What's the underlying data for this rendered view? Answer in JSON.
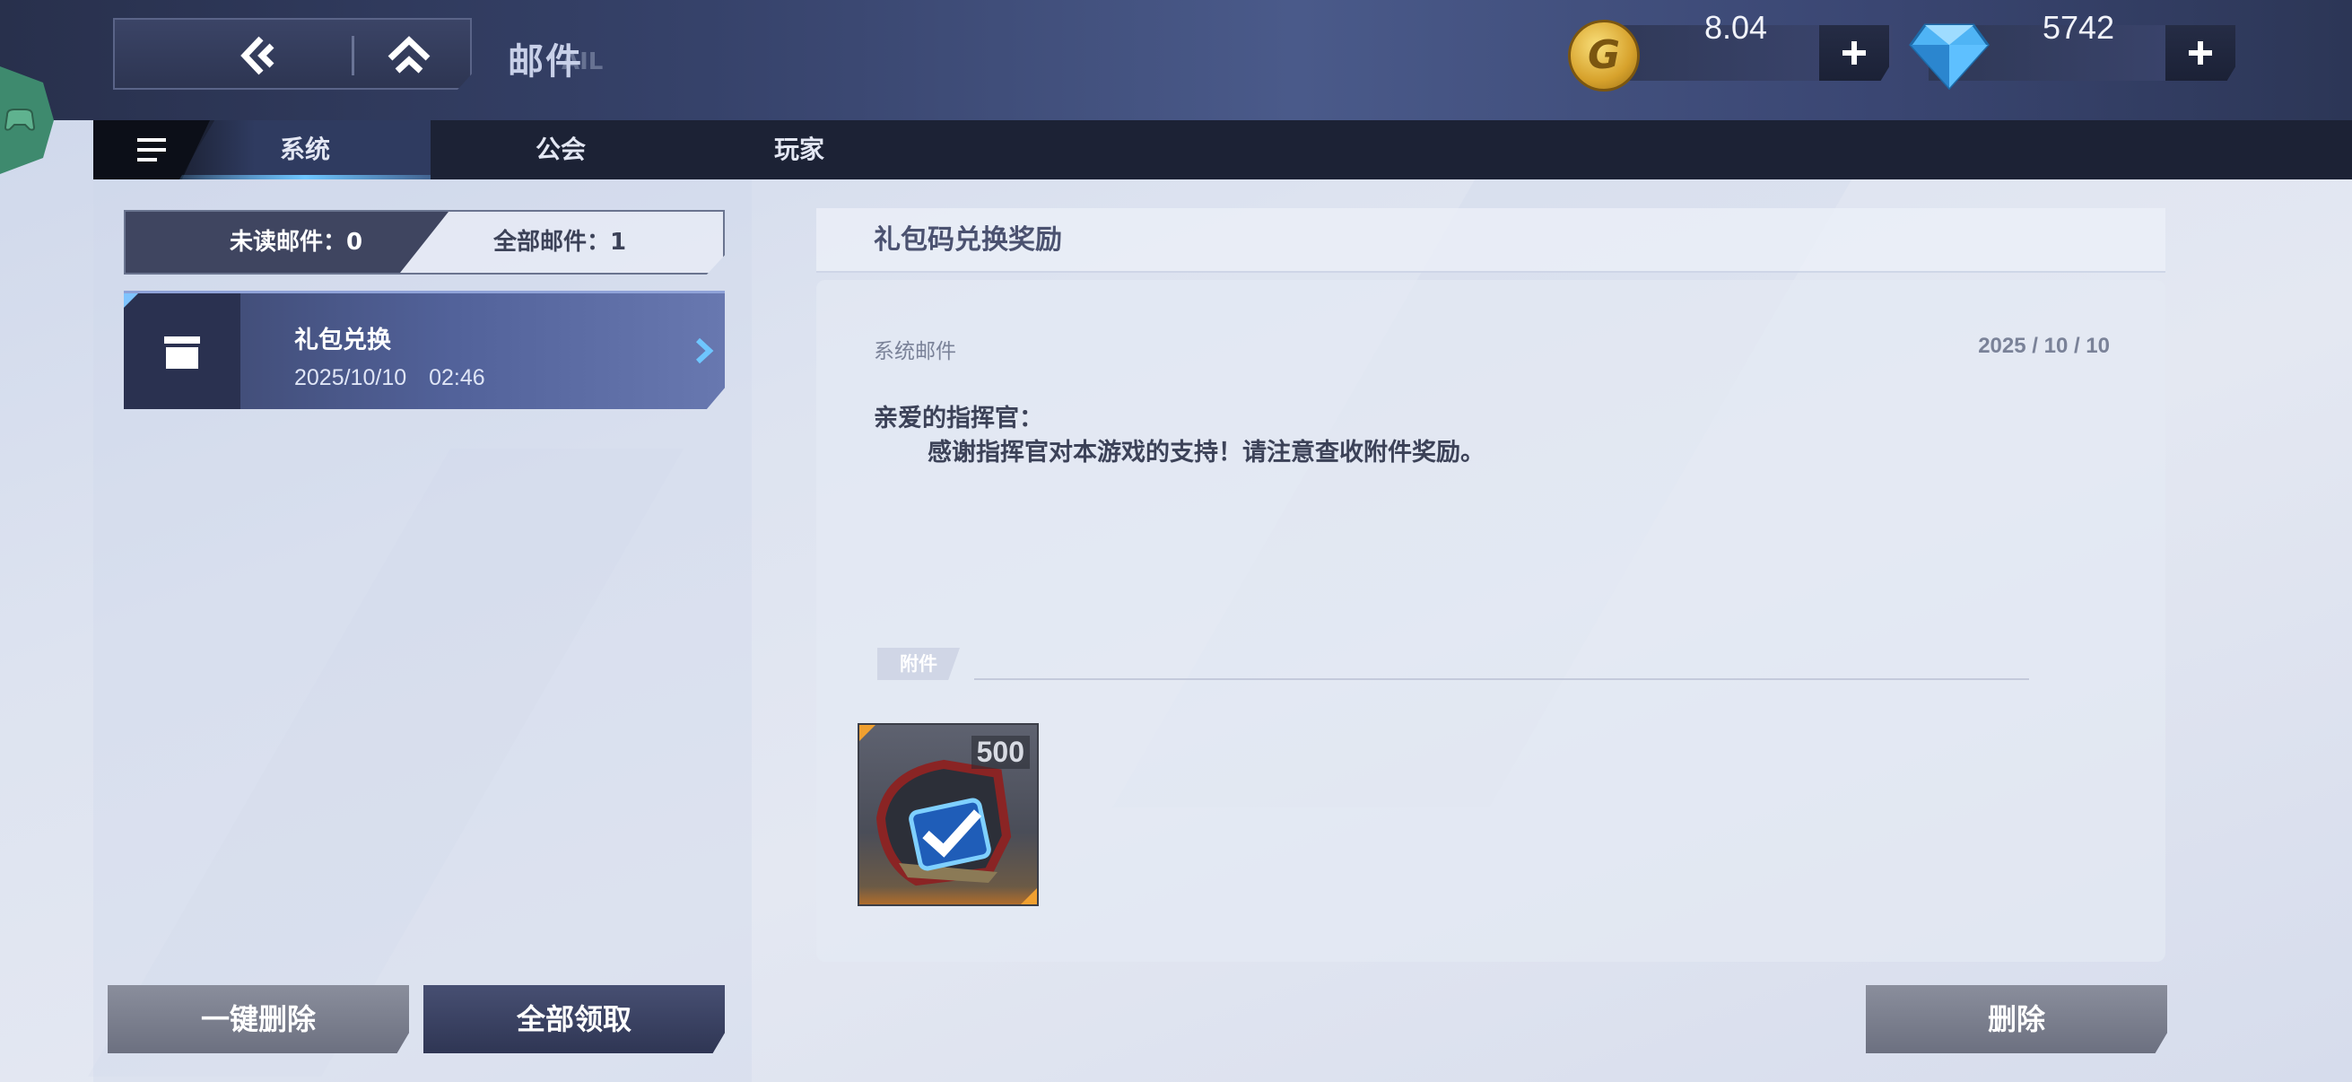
{
  "header": {
    "title": "邮件",
    "title_watermark": "AIL",
    "gold": "8.04",
    "diamond": "5742"
  },
  "tabs": [
    {
      "label": "系统",
      "active": true
    },
    {
      "label": "公会",
      "active": false
    },
    {
      "label": "玩家",
      "active": false
    }
  ],
  "counters": {
    "unread": "未读邮件：0",
    "all": "全部邮件：1"
  },
  "mail_list": [
    {
      "title": "礼包兑换",
      "date": "2025/10/10　02:46"
    }
  ],
  "mail_detail": {
    "subject": "礼包码兑换奖励",
    "sender": "系统邮件",
    "date": "2025 / 10 / 10",
    "greeting": "亲爱的指挥官：",
    "body": "感谢指挥官对本游戏的支持！请注意查收附件奖励。",
    "attachment_label": "附件",
    "attachments": [
      {
        "icon": "chip-check-icon",
        "quantity": "500"
      }
    ]
  },
  "buttons": {
    "delete_all": "一键删除",
    "claim_all": "全部领取",
    "delete": "删除"
  },
  "colors": {
    "topbar": "#36426a",
    "tab_active_underline": "#6ec6ff",
    "button_dark": "#3a4264",
    "button_grey": "#7a7f90",
    "attachment_corner": "#f0a030"
  }
}
